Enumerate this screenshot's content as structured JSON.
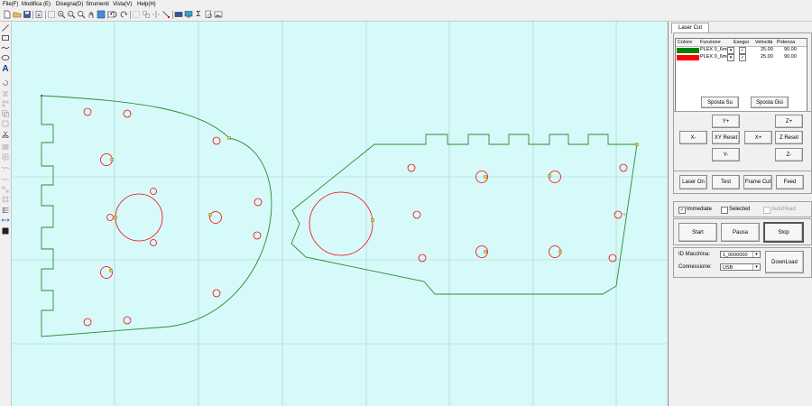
{
  "menu": [
    "File(F)",
    "Modifica (E)",
    "Disegna(D)",
    "Strumenti",
    "Vista(V)",
    "Help(H)"
  ],
  "toolbar_icons": [
    "new-icon",
    "open-icon",
    "save-icon",
    "import-icon",
    "select-icon",
    "zoom-in-icon",
    "zoom-out-icon",
    "zoom-fit-icon",
    "pan-icon",
    "zoom-window-icon",
    "page-icon",
    "undo-icon",
    "redo-icon",
    "group-icon",
    "ungroup-icon",
    "mirror-h-icon",
    "mirror-v-icon",
    "node-edit-icon",
    "laser-icon",
    "monitor-icon",
    "sum-icon",
    "document-icon",
    "image-icon"
  ],
  "left_tools": [
    "line-icon",
    "rectangle-icon",
    "curve-icon",
    "ellipse-icon",
    "text-icon",
    "rotate-icon",
    "align-icon",
    "array-icon",
    "offset-icon",
    "scissors-icon",
    "fill-icon",
    "grid-icon",
    "wave-icon",
    "snap-icon",
    "node-icon",
    "table-icon",
    "arrows-icon",
    "black-square-icon"
  ],
  "panel": {
    "tab": "Laser Cut",
    "table_headers": [
      "Colore",
      "Funzione",
      "Esegui",
      "Velocità",
      "Potenza"
    ],
    "layers": [
      {
        "color": "#008000",
        "function": "PLEX 0_6mm",
        "execute": "✓",
        "speed": "25.00",
        "power": "90.00"
      },
      {
        "color": "#ff0000",
        "function": "PLEX 0_6mm",
        "execute": "✓",
        "speed": "25.00",
        "power": "90.00"
      }
    ],
    "move_up": "Sposta Su",
    "move_down": "Sposta Giù",
    "jog": {
      "y_plus": "Y+",
      "z_plus": "Z+",
      "x_minus": "X-",
      "xy_reset": "XY Reset",
      "x_plus": "X+",
      "z_reset": "Z Reset",
      "y_minus": "Y-",
      "z_minus": "Z-"
    },
    "actions": {
      "laser_on": "Laser On",
      "test": "Test",
      "frame_cut": "Frame Cut",
      "feed": "Feed"
    },
    "options": {
      "immediate": "Immediate",
      "immediate_checked": true,
      "selected": "Selected",
      "selected_checked": false,
      "autohead": "AutoHead",
      "autohead_checked": false
    },
    "run": {
      "start": "Start",
      "pause": "Pausa",
      "stop": "Stop"
    },
    "machine_id_label": "ID Macchina:",
    "machine_id_value": "1_0000000",
    "connection_label": "Connessione:",
    "connection_value": "USB",
    "download": "DownLoad"
  },
  "colors": {
    "canvas": "#d6fafa",
    "grid": "#aac8c8",
    "outline": "#2e8b2e",
    "holes": "#ff0000",
    "node": "#c8a000"
  }
}
